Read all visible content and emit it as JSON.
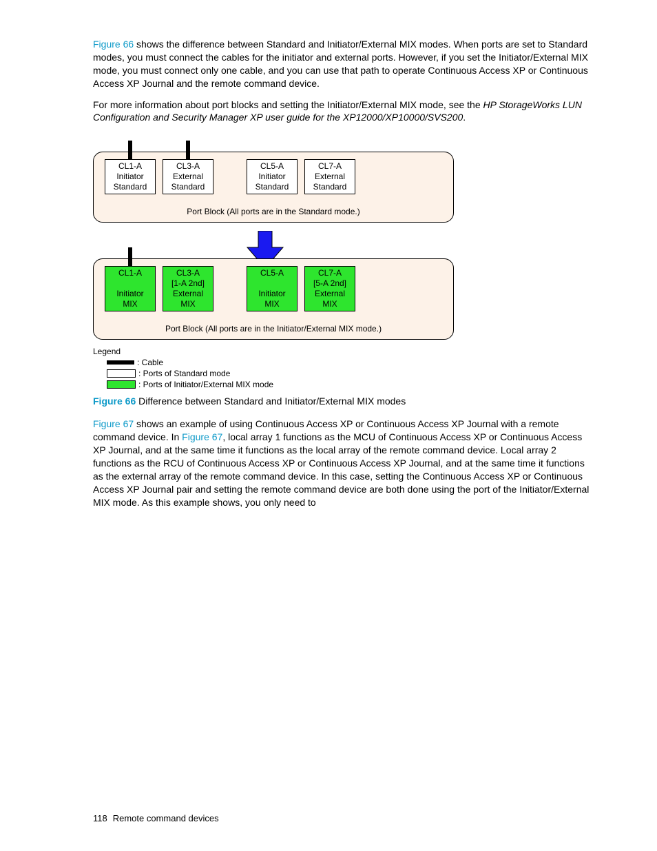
{
  "para1": {
    "link": "Figure 66",
    "rest": " shows the difference between Standard and Initiator/External MIX modes. When ports are set to Standard modes, you must connect the cables for the initiator and external ports. However, if you set the Initiator/External MIX mode, you must connect only one cable, and you can use that path to operate Continuous Access XP or Continuous Access XP Journal and the remote command device."
  },
  "para2": {
    "lead": "For more information about port blocks and setting the Initiator/External MIX mode, see the ",
    "italic": "HP StorageWorks LUN Configuration and Security Manager XP user guide for the XP12000/XP10000/SVS200",
    "tail": "."
  },
  "diagram": {
    "top_block": {
      "ports": [
        {
          "lines": [
            "CL1-A",
            "Initiator",
            "Standard"
          ],
          "cable": true,
          "green": false
        },
        {
          "lines": [
            "CL3-A",
            "External",
            "Standard"
          ],
          "cable": true,
          "green": false
        },
        {
          "lines": [
            "CL5-A",
            "Initiator",
            "Standard"
          ],
          "cable": false,
          "green": false
        },
        {
          "lines": [
            "CL7-A",
            "External",
            "Standard"
          ],
          "cable": false,
          "green": false
        }
      ],
      "caption": "Port Block (All ports are in the Standard mode.)"
    },
    "bottom_block": {
      "ports": [
        {
          "lines": [
            "CL1-A",
            "",
            "Initiator",
            "MIX"
          ],
          "cable": true,
          "green": true
        },
        {
          "lines": [
            "CL3-A",
            "[1-A 2nd]",
            "External",
            "MIX"
          ],
          "cable": false,
          "green": true
        },
        {
          "lines": [
            "CL5-A",
            "",
            "Initiator",
            "MIX"
          ],
          "cable": false,
          "green": true
        },
        {
          "lines": [
            "CL7-A",
            "[5-A 2nd]",
            "External",
            "MIX"
          ],
          "cable": false,
          "green": true
        }
      ],
      "caption": "Port Block (All ports are in the Initiator/External MIX mode.)"
    },
    "legend": {
      "title": "Legend",
      "items": [
        {
          "swatch": "black",
          "label": ": Cable"
        },
        {
          "swatch": "white",
          "label": ": Ports of Standard mode"
        },
        {
          "swatch": "green",
          "label": ": Ports of Initiator/External MIX mode"
        }
      ]
    }
  },
  "figcaption": {
    "label": "Figure 66",
    "text": " Difference between Standard and Initiator/External MIX modes"
  },
  "para3": {
    "link1": "Figure 67",
    "t1": " shows an example of using Continuous Access XP or Continuous Access XP Journal with a remote command device. In ",
    "link2": "Figure 67",
    "t2": ", local array 1 functions as the MCU of Continuous Access XP or Continuous Access XP Journal, and at the same time it functions as the local array of the remote command device. Local array 2 functions as the RCU of Continuous Access XP or Continuous Access XP Journal, and at the same time it functions as the external array of the remote command device. In this case, setting the Continuous Access XP or Continuous Access XP Journal pair and setting the remote command device are both done using the port of the Initiator/External MIX mode. As this example shows, you only need to"
  },
  "footer": {
    "page": "118",
    "section": "Remote command devices"
  }
}
